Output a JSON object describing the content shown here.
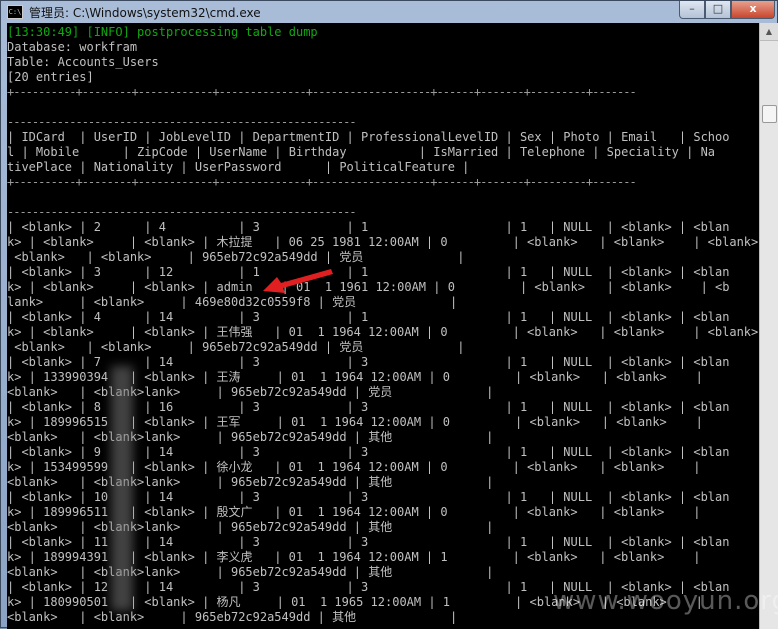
{
  "window": {
    "title": "管理员: C:\\Windows\\system32\\cmd.exe",
    "icon_text": "C:\\",
    "controls": {
      "minimize": "–",
      "maximize": "□",
      "close": "x"
    }
  },
  "console": {
    "lines": [
      "[13:30:49] [INFO] postprocessing table dump",
      "Database: workfram",
      "Table: Accounts_Users",
      "[20 entries]",
      "+----------+--------+------------+--------------+-------------------+------+-------+---------+-------",
      "",
      "--------------------------------------------------------",
      "| IDCard  | UserID | JobLevelID | DepartmentID | ProfessionalLevelID | Sex | Photo | Email   | Schoo",
      "l | Mobile      | ZipCode | UserName | Birthday          | IsMarried | Telephone | Speciality | Na",
      "tivePlace | Nationality | UserPassword      | PoliticalFeature |",
      "+----------+--------+------------+--------------+-------------------+------+-------+---------+-------",
      "",
      "--------------------------------------------------------",
      "| <blank> | 2      | 4          | 3            | 1                   | 1   | NULL  | <blank> | <blan",
      "k> | <blank>     | <blank> | 木拉提   | 06 25 1981 12:00AM | 0         | <blank>   | <blank>    | <blank>",
      " <blank>   | <blank>     | 965eb72c92a549dd | 党员             |",
      "| <blank> | 3      | 12         | 1            | 1                   | 1   | NULL  | <blank> | <blan",
      "k> | <blank>     | <blank> | admin    | 01  1 1961 12:00AM | 0         | <blank>   | <blank>    | <b",
      "lank>     | <blank>     | 469e80d32c0559f8 | 党员             |",
      "| <blank> | 4      | 14         | 3            | 1                   | 1   | NULL  | <blank> | <blan",
      "k> | <blank>     | <blank> | 王伟强   | 01  1 1964 12:00AM | 0         | <blank>   | <blank>    | <blank>",
      " <blank>   | <blank>     | 965eb72c92a549dd | 党员             |",
      "| <blank> | 7      | 14         | 3            | 3                   | 1   | NULL  | <blank> | <blan",
      "k> | 133990394   | <blank> | 王涛     | 01  1 1964 12:00AM | 0         | <blank>   | <blank>    | ",
      "<blank>   | <blank>lank>     | 965eb72c92a549dd | 党员             |",
      "| <blank> | 8      | 16         | 3            | 3                   | 1   | NULL  | <blank> | <blan",
      "k> | 189996515   | <blank> | 王军     | 01  1 1964 12:00AM | 0         | <blank>   | <blank>    | ",
      "<blank>   | <blank>lank>     | 965eb72c92a549dd | 其他             |",
      "| <blank> | 9      | 14         | 3            | 3                   | 1   | NULL  | <blank> | <blan",
      "k> | 153499599   | <blank> | 徐小龙   | 01  1 1964 12:00AM | 0         | <blank>   | <blank>    | ",
      "<blank>   | <blank>lank>     | 965eb72c92a549dd | 其他             |",
      "| <blank> | 10     | 14         | 3            | 3                   | 1   | NULL  | <blank> | <blan",
      "k> | 189996511   | <blank> | 殷文广   | 01  1 1964 12:00AM | 0         | <blank>   | <blank>    | ",
      "<blank>   | <blank>lank>     | 965eb72c92a549dd | 其他             |",
      "| <blank> | 11     | 14         | 3            | 3                   | 1   | NULL  | <blank> | <blan",
      "k> | 189994391   | <blank> | 李义虎   | 01  1 1964 12:00AM | 1         | <blank>   | <blank>    | ",
      "<blank>   | <blank>lank>     | 965eb72c92a549dd | 其他             |",
      "| <blank> | 12     | 14         | 3            | 3                   | 1   | NULL  | <blank> | <blan",
      "k> | 180990501   | <blank> | 杨凡     | 01  1 1965 12:00AM | 1         | <blank>   | <blank>    | ",
      "<blank>   | <blank>     | 965eb72c92a549dd | 其他             |"
    ]
  },
  "watermark": "www.wooyun.org"
}
